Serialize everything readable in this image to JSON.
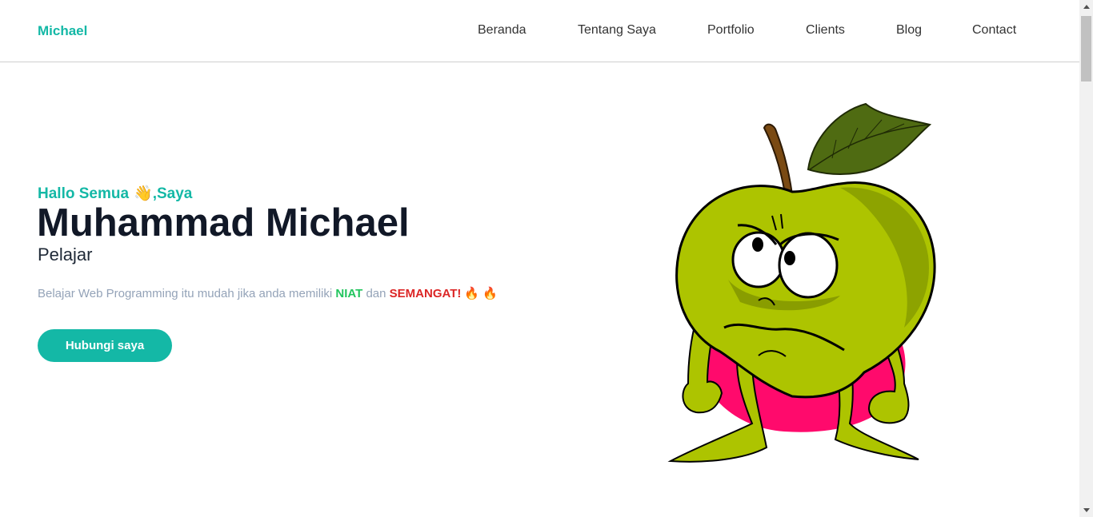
{
  "navbar": {
    "brand": "Michael",
    "items": [
      {
        "label": "Beranda"
      },
      {
        "label": "Tentang Saya"
      },
      {
        "label": "Portfolio"
      },
      {
        "label": "Clients"
      },
      {
        "label": "Blog"
      },
      {
        "label": "Contact"
      }
    ]
  },
  "hero": {
    "greeting_prefix": "Hallo Semua",
    "greeting_emoji": "👋",
    "greeting_suffix": ",Saya",
    "name": "Muhammad Michael",
    "role": "Pelajar",
    "description": {
      "part1": "Belajar Web Programming itu mudah jika anda memiliki ",
      "highlight1": "NIAT",
      "part2": " dan ",
      "highlight2": "SEMANGAT!",
      "emoji1": "🔥",
      "emoji2": "🔥"
    },
    "button_label": "Hubungi saya",
    "illustration": "grumpy-green-apple-cartoon"
  },
  "colors": {
    "accent": "#14b8a6",
    "niat": "#22c55e",
    "semangat": "#dc2626",
    "blob": "#ff0a6c",
    "apple": "#adc400"
  }
}
